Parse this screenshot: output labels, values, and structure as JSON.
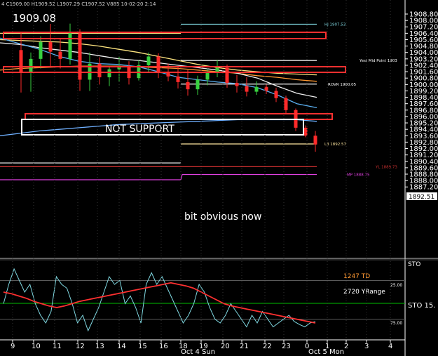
{
  "header": {
    "info": "4 C1909.00 H1909.52 L1907.29 C1907.52 V885 10-02-20 2:14",
    "current_price": "1909.08"
  },
  "annotations": {
    "not_support": "NOT SUPPORT",
    "bit_obvious": "bit obvious now"
  },
  "chart_data": [
    {
      "type": "candlestick",
      "title": "",
      "ylim": [
        1887.0,
        1909.0
      ],
      "x_ticks": [
        "9",
        "10",
        "11",
        "12",
        "13",
        "14",
        "15",
        "16",
        "18",
        "19",
        "20",
        "21",
        "22",
        "23",
        "0",
        "1",
        "2",
        "3",
        "4"
      ],
      "date_labels": [
        "Oct 4 Sun",
        "Oct 5 Mon"
      ],
      "y_ticks": [
        "1908.80",
        "1908.00",
        "1907.20",
        "1906.40",
        "1905.60",
        "1904.80",
        "1904.00",
        "1903.20",
        "1902.40",
        "1901.60",
        "1900.80",
        "1900.00",
        "1899.20",
        "1898.40",
        "1897.60",
        "1896.80",
        "1896.00",
        "1895.20",
        "1894.40",
        "1893.60",
        "1892.80",
        "1892.00",
        "1891.20",
        "1890.40",
        "1889.60",
        "1888.80",
        "1888.00",
        "1887.20"
      ],
      "last_price_label": "1892.51",
      "levels": [
        {
          "name": "HJ 1907.53",
          "value": 1907.53,
          "color": "#7fd7e0"
        },
        {
          "name": "Yest Mid Point 1903",
          "value": 1903.0,
          "color": "#ffffff"
        },
        {
          "name": "ROVR 1900.05",
          "value": 1900.05,
          "color": "#ffffff"
        },
        {
          "name": "L3 1892.57",
          "value": 1892.57,
          "color": "#ffe7a0"
        },
        {
          "name": "YL 1889.73",
          "value": 1889.73,
          "color": "#cc3030"
        },
        {
          "name": "MP 1888.75",
          "value": 1888.75,
          "color": "#e040e0"
        }
      ],
      "candles": [
        {
          "o": 1904.3,
          "h": 1906.5,
          "l": 1899.0,
          "c": 1901.5
        },
        {
          "o": 1901.5,
          "h": 1904.0,
          "l": 1899.1,
          "c": 1903.2
        },
        {
          "o": 1903.2,
          "h": 1906.0,
          "l": 1902.0,
          "c": 1905.3
        },
        {
          "o": 1905.3,
          "h": 1908.2,
          "l": 1902.2,
          "c": 1904.1
        },
        {
          "o": 1904.1,
          "h": 1905.8,
          "l": 1902.0,
          "c": 1903.2
        },
        {
          "o": 1903.2,
          "h": 1907.6,
          "l": 1902.5,
          "c": 1906.4
        },
        {
          "o": 1906.4,
          "h": 1906.9,
          "l": 1899.2,
          "c": 1900.6
        },
        {
          "o": 1900.6,
          "h": 1904.0,
          "l": 1899.2,
          "c": 1902.6
        },
        {
          "o": 1902.6,
          "h": 1903.4,
          "l": 1900.0,
          "c": 1900.9
        },
        {
          "o": 1900.9,
          "h": 1902.3,
          "l": 1899.8,
          "c": 1901.9
        },
        {
          "o": 1901.9,
          "h": 1903.5,
          "l": 1900.3,
          "c": 1902.2
        },
        {
          "o": 1902.2,
          "h": 1902.9,
          "l": 1900.0,
          "c": 1900.8
        },
        {
          "o": 1900.8,
          "h": 1903.0,
          "l": 1900.5,
          "c": 1902.4
        },
        {
          "o": 1902.4,
          "h": 1904.0,
          "l": 1901.5,
          "c": 1903.5
        },
        {
          "o": 1903.5,
          "h": 1903.9,
          "l": 1900.8,
          "c": 1901.6
        },
        {
          "o": 1901.6,
          "h": 1902.6,
          "l": 1900.4,
          "c": 1901.0
        },
        {
          "o": 1901.0,
          "h": 1902.2,
          "l": 1899.5,
          "c": 1900.3
        },
        {
          "o": 1900.3,
          "h": 1901.8,
          "l": 1898.6,
          "c": 1899.4
        },
        {
          "o": 1899.4,
          "h": 1901.1,
          "l": 1898.7,
          "c": 1900.6
        },
        {
          "o": 1900.6,
          "h": 1902.0,
          "l": 1899.9,
          "c": 1901.5
        },
        {
          "o": 1901.5,
          "h": 1903.1,
          "l": 1900.9,
          "c": 1902.1
        },
        {
          "o": 1902.1,
          "h": 1902.5,
          "l": 1899.6,
          "c": 1900.2
        },
        {
          "o": 1900.2,
          "h": 1901.2,
          "l": 1899.0,
          "c": 1899.8
        },
        {
          "o": 1899.8,
          "h": 1900.9,
          "l": 1898.5,
          "c": 1899.1
        },
        {
          "o": 1899.1,
          "h": 1900.4,
          "l": 1898.7,
          "c": 1899.7
        },
        {
          "o": 1899.7,
          "h": 1900.0,
          "l": 1898.8,
          "c": 1899.2
        },
        {
          "o": 1899.2,
          "h": 1899.6,
          "l": 1897.8,
          "c": 1898.3
        },
        {
          "o": 1898.3,
          "h": 1898.6,
          "l": 1896.4,
          "c": 1896.8
        },
        {
          "o": 1896.8,
          "h": 1897.0,
          "l": 1894.2,
          "c": 1894.6
        },
        {
          "o": 1894.6,
          "h": 1894.9,
          "l": 1893.4,
          "c": 1893.6
        },
        {
          "o": 1893.6,
          "h": 1894.2,
          "l": 1891.6,
          "c": 1892.51
        }
      ],
      "moving_averages": [
        {
          "color": "#ffe680",
          "values": [
            1905.6,
            1905.5,
            1905.4,
            1905.3,
            1905.1,
            1904.8,
            1904.4,
            1904.0,
            1903.5,
            1903.0,
            1902.5,
            1902.1,
            1901.8,
            1901.6,
            1901.4,
            1901.3,
            1901.2
          ]
        },
        {
          "color": "#ff9933",
          "values": [
            1901.8,
            1902.0,
            1902.1,
            1902.2,
            1902.3,
            1902.3,
            1902.3,
            1902.2,
            1902.1,
            1902.0,
            1901.8,
            1901.6,
            1901.4,
            1901.1,
            1900.9,
            1900.6,
            1900.4
          ]
        },
        {
          "color": "#eeeeee",
          "values": [
            1905.2,
            1905.0,
            1904.6,
            1904.3,
            1904.0,
            1903.6,
            1903.2,
            1903.0,
            1902.7,
            1902.4,
            1902.1,
            1901.8,
            1901.4,
            1900.8,
            1899.8,
            1898.9,
            1898.4
          ]
        },
        {
          "color": "#5aaff0",
          "values": [
            1905.8,
            1905.1,
            1904.4,
            1903.5,
            1902.9,
            1902.6,
            1902.5,
            1902.2,
            1901.6,
            1900.9,
            1900.6,
            1900.3,
            1900.1,
            1899.6,
            1898.7,
            1897.6,
            1897.1
          ]
        },
        {
          "color": "#6fb0ff",
          "values": [
            1893.6,
            1893.9,
            1894.2,
            1894.4,
            1894.6,
            1894.8,
            1895.0,
            1895.1,
            1895.2,
            1895.3,
            1895.4,
            1895.5,
            1895.6,
            1895.6,
            1895.6,
            1895.6,
            1895.4
          ]
        }
      ]
    },
    {
      "type": "line",
      "title": "",
      "labels": [
        "1247 TD",
        "2720 YRange"
      ],
      "y_ticks": [
        "25.00",
        "STO 15.",
        "75.00"
      ],
      "indicator": "STO",
      "ylim": [
        0,
        100
      ],
      "series": [
        {
          "color": "#7fd7e0",
          "values": [
            55,
            30,
            10,
            25,
            40,
            30,
            55,
            70,
            80,
            65,
            20,
            30,
            35,
            55,
            80,
            70,
            90,
            75,
            60,
            40,
            20,
            30,
            25,
            55,
            45,
            60,
            80,
            30,
            15,
            30,
            20,
            35,
            50,
            65,
            80,
            70,
            55,
            30,
            40,
            60,
            75,
            80,
            70,
            55,
            65,
            75,
            85,
            70,
            80,
            65,
            75,
            85,
            80,
            75,
            70,
            78,
            82,
            85,
            80,
            78
          ]
        },
        {
          "color": "#ff3030",
          "values": [
            40,
            42,
            45,
            48,
            52,
            55,
            58,
            60,
            58,
            55,
            52,
            50,
            48,
            46,
            44,
            42,
            40,
            38,
            36,
            34,
            32,
            30,
            28,
            30,
            32,
            35,
            40,
            45,
            50,
            55,
            58,
            60,
            62,
            64,
            66,
            68,
            70,
            72,
            74,
            76,
            78,
            80
          ]
        }
      ]
    }
  ]
}
